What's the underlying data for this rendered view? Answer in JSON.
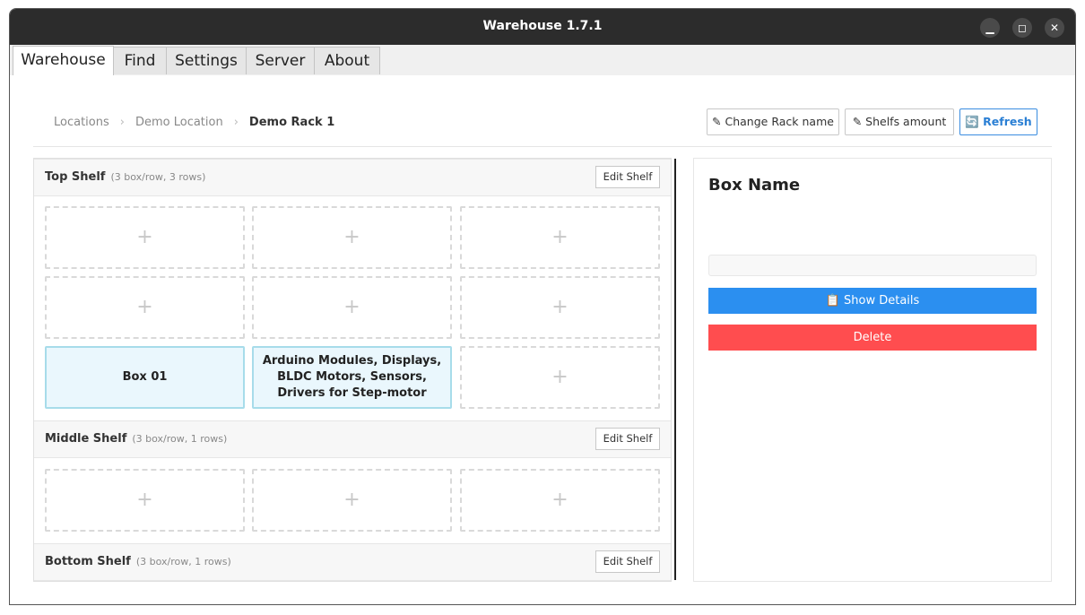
{
  "window": {
    "title": "Warehouse 1.7.1",
    "controls": [
      "minimize",
      "maximize",
      "close"
    ]
  },
  "tabs": [
    {
      "label": "Warehouse",
      "active": true
    },
    {
      "label": "Find"
    },
    {
      "label": "Settings"
    },
    {
      "label": "Server"
    },
    {
      "label": "About"
    }
  ],
  "breadcrumb": [
    "Locations",
    "Demo Location",
    "Demo Rack 1"
  ],
  "toolbar": {
    "change_rack": "✎ Change Rack name",
    "shelfs_amount": "✎ Shelfs amount",
    "refresh": "🔄 Refresh"
  },
  "shelves": [
    {
      "name": "Top Shelf",
      "meta": "(3 box/row, 3 rows)",
      "edit": "Edit Shelf",
      "boxes": [
        "Box 01",
        "Arduino Modules, Displays, BLDC Motors, Sensors, Drivers for Step-motor"
      ]
    },
    {
      "name": "Middle Shelf",
      "meta": "(3 box/row, 1 rows)",
      "edit": "Edit Shelf"
    },
    {
      "name": "Bottom Shelf",
      "meta": "(3 box/row, 1 rows)",
      "edit": "Edit Shelf"
    }
  ],
  "empty_slot": "+",
  "details": {
    "title": "Box Name",
    "show_details": "📋 Show Details",
    "delete": "Delete"
  },
  "colors": {
    "accent": "#2b8ff0",
    "danger": "#ff4d4f",
    "box_fill": "#eaf7fd",
    "titlebar": "#2c2c2c"
  }
}
